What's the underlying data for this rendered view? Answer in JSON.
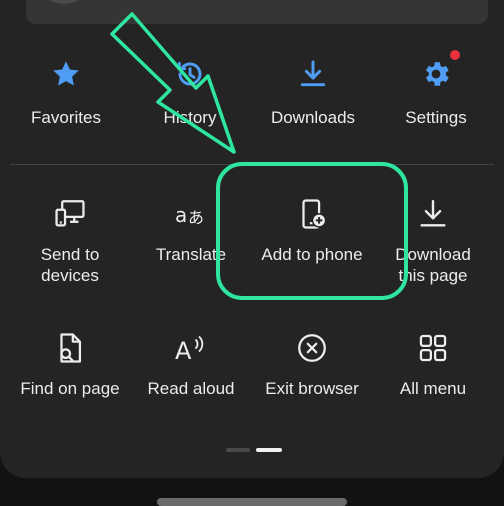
{
  "colors": {
    "accent_blue": "#4f9df5",
    "icon_white": "#ececec",
    "badge_red": "#e8313b",
    "highlight_green": "#2ee6a0"
  },
  "quick_actions": [
    {
      "label": "Favorites",
      "icon": "star-icon"
    },
    {
      "label": "History",
      "icon": "history-icon"
    },
    {
      "label": "Downloads",
      "icon": "download-icon"
    },
    {
      "label": "Settings",
      "icon": "gear-icon"
    }
  ],
  "menu_items": [
    {
      "label": "Send to devices",
      "icon": "send-to-devices-icon"
    },
    {
      "label": "Translate",
      "icon": "translate-icon"
    },
    {
      "label": "Add to phone",
      "icon": "add-to-phone-icon"
    },
    {
      "label": "Download this page",
      "icon": "download-page-icon"
    },
    {
      "label": "Find on page",
      "icon": "find-on-page-icon"
    },
    {
      "label": "Read aloud",
      "icon": "read-aloud-icon"
    },
    {
      "label": "Exit browser",
      "icon": "exit-browser-icon"
    },
    {
      "label": "All menu",
      "icon": "all-menu-icon"
    }
  ],
  "pager": {
    "pages": 2,
    "current": 2
  }
}
